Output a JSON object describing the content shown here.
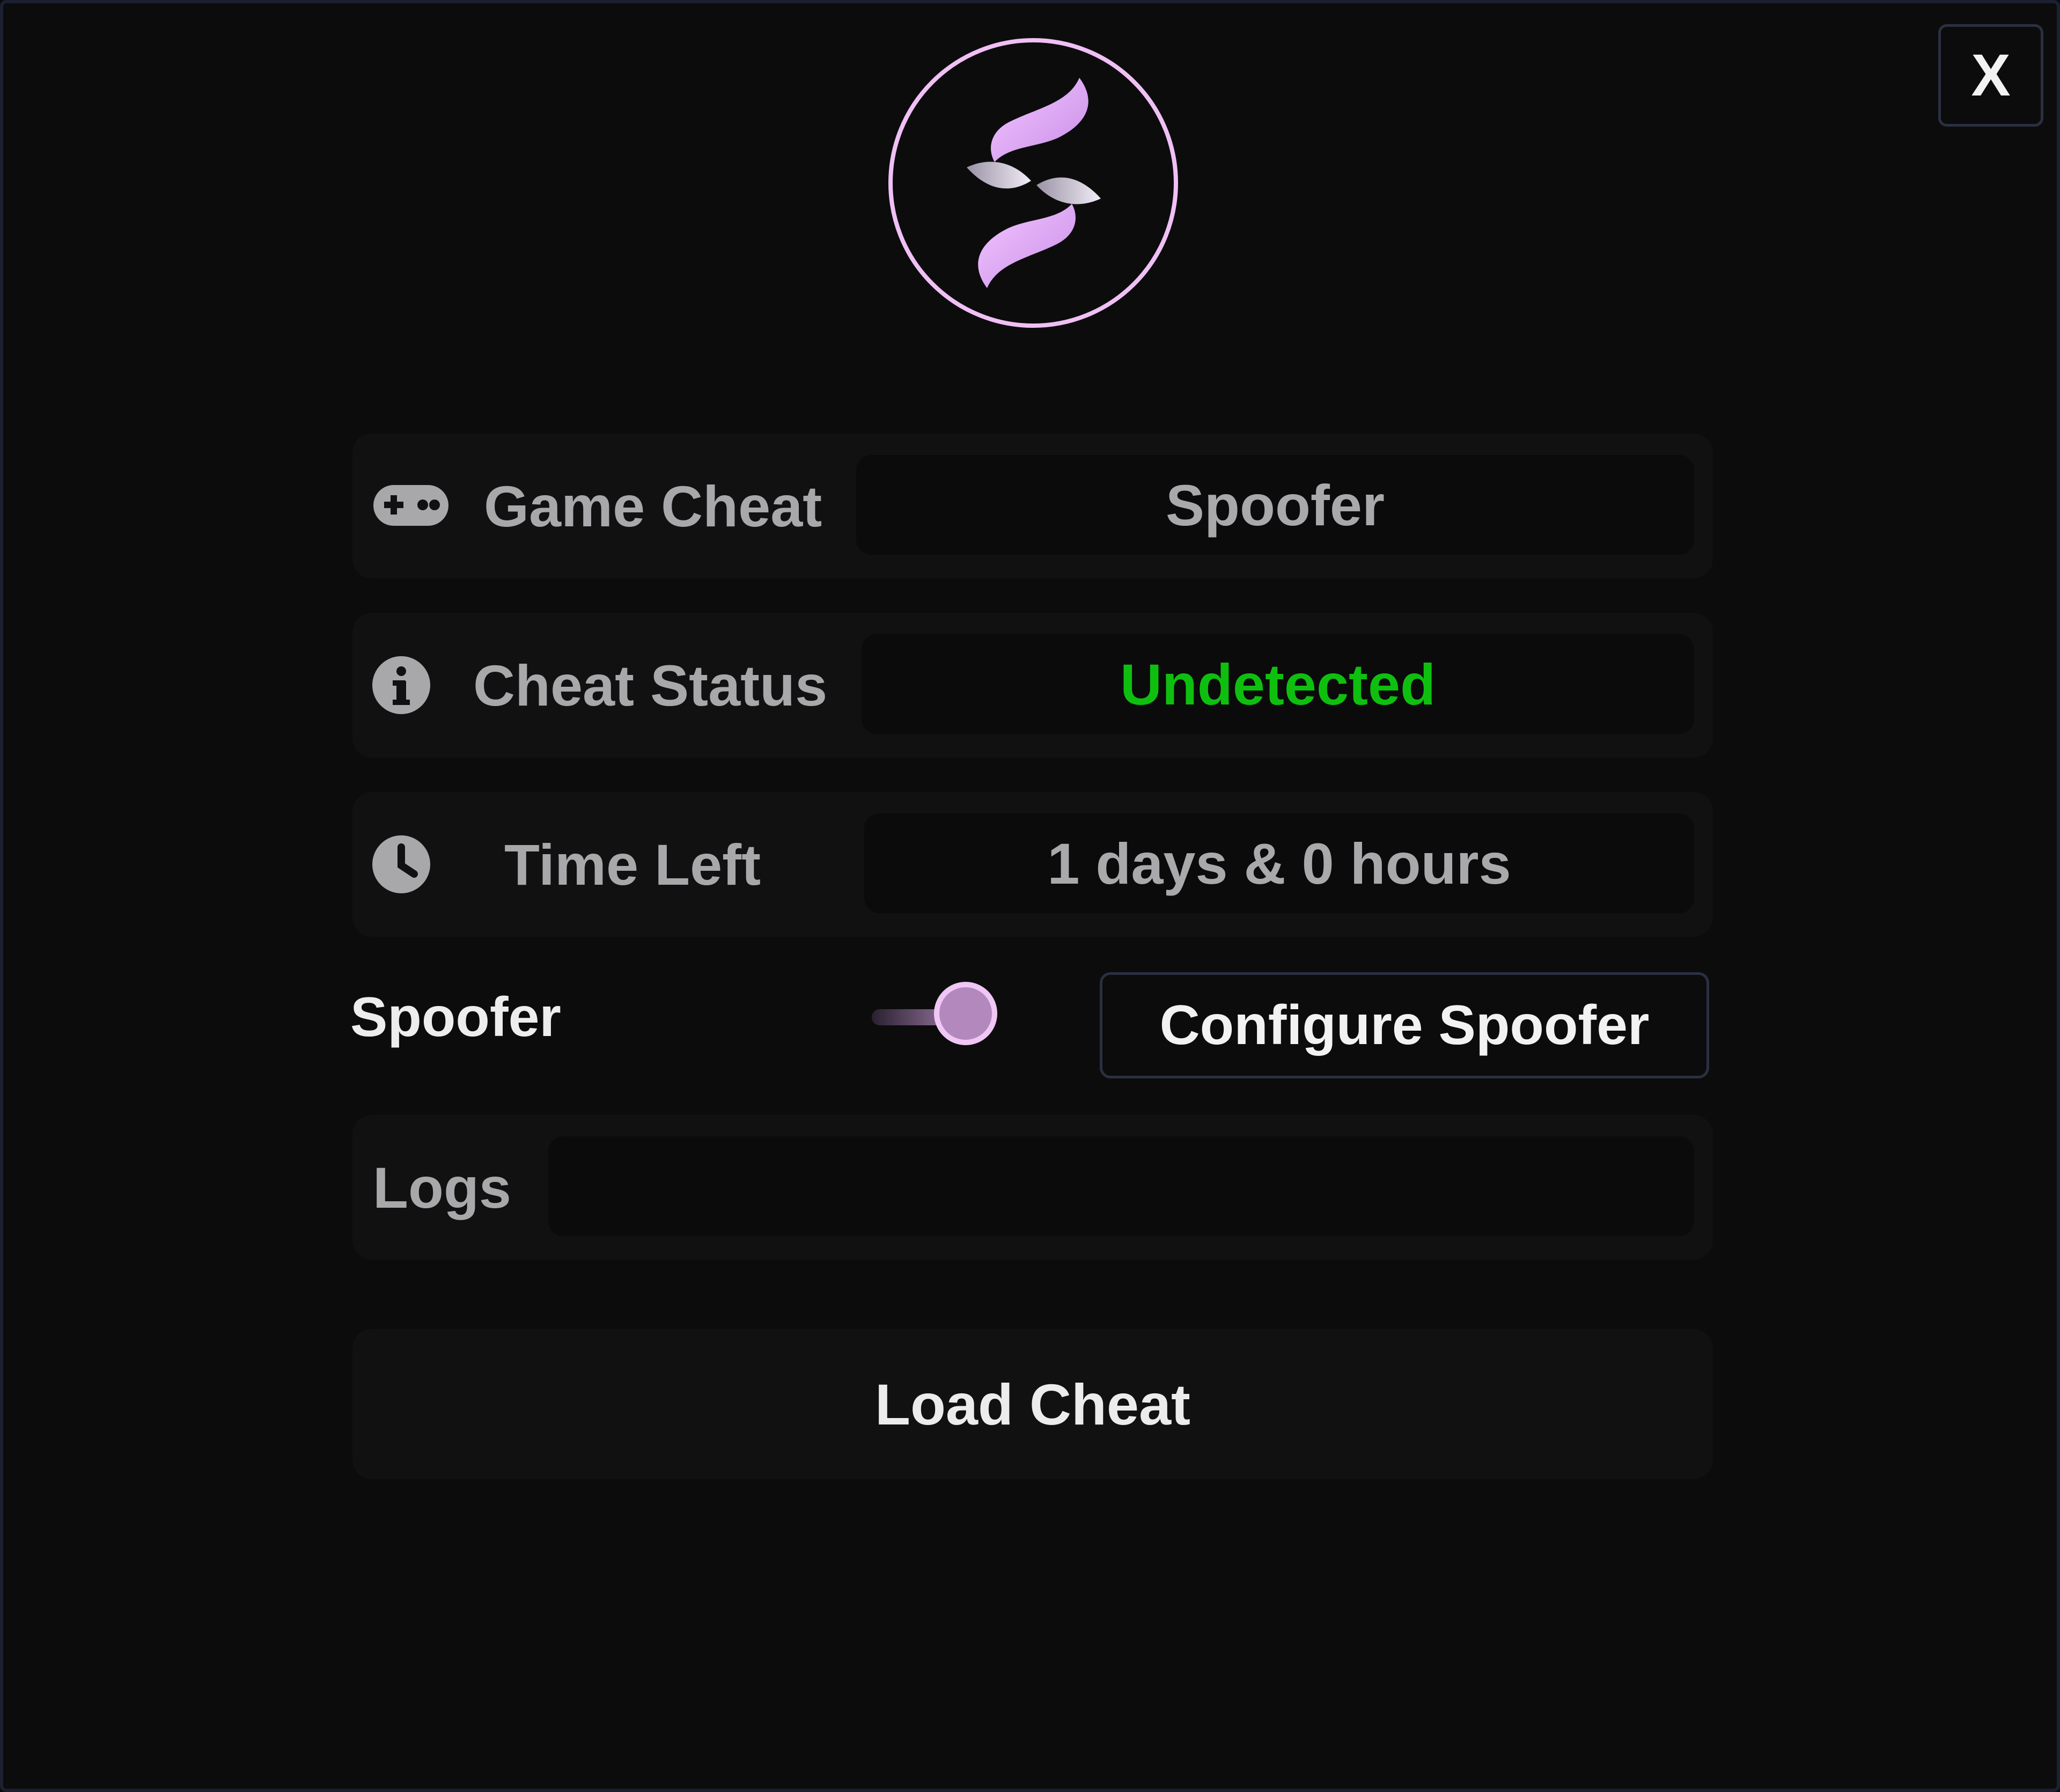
{
  "window": {
    "close_label": "X"
  },
  "rows": {
    "game_cheat": {
      "label": "Game Cheat",
      "value": "Spoofer",
      "icon": "gamepad-icon"
    },
    "cheat_status": {
      "label": "Cheat Status",
      "value": "Undetected",
      "value_color": "#0fbf0f",
      "icon": "info-icon"
    },
    "time_left": {
      "label": "Time Left",
      "value": "1 days & 0 hours",
      "icon": "clock-icon"
    }
  },
  "spoofer": {
    "label": "Spoofer",
    "enabled": true,
    "configure_label": "Configure Spoofer"
  },
  "logs": {
    "label": "Logs",
    "content": ""
  },
  "actions": {
    "load_label": "Load Cheat"
  },
  "colors": {
    "accent": "#e7aef5",
    "background": "#0c0c0d",
    "status_ok": "#0fbf0f"
  }
}
